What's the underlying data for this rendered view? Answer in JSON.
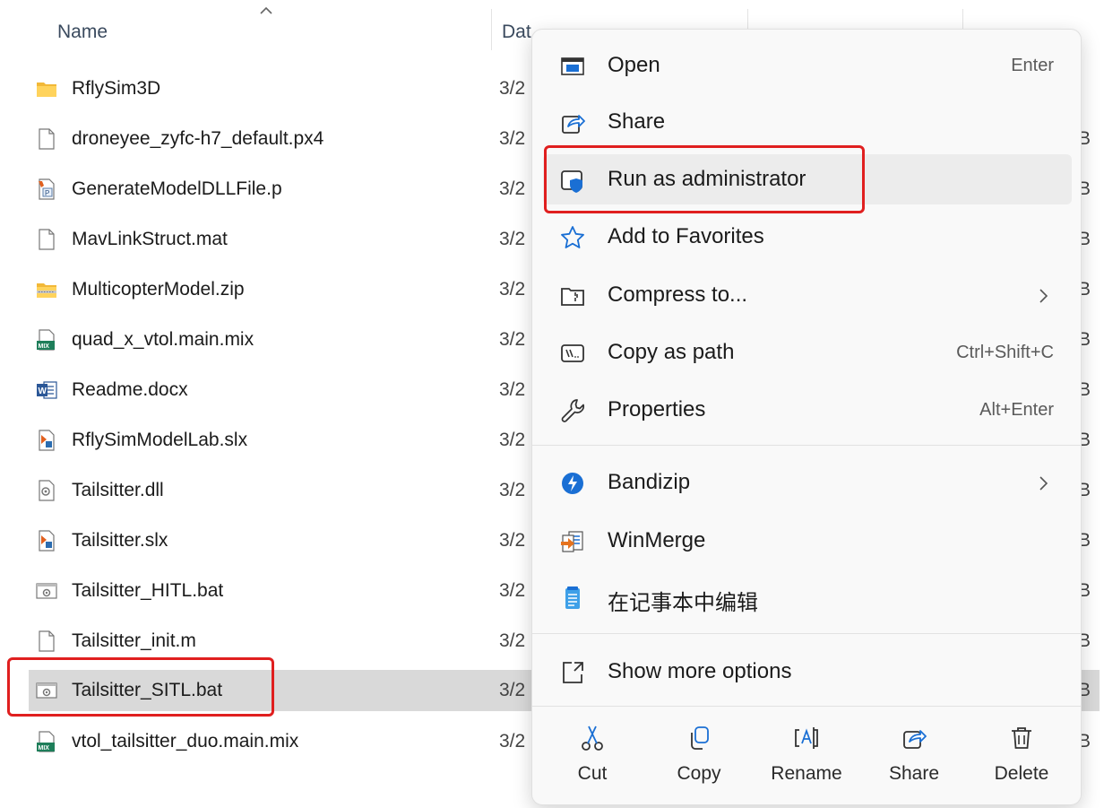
{
  "header": {
    "name_label": "Name",
    "date_label": "Dat"
  },
  "files": [
    {
      "name": "RflySim3D",
      "date": "3/2",
      "size": "",
      "icon": "folder-icon"
    },
    {
      "name": "droneyee_zyfc-h7_default.px4",
      "date": "3/2",
      "size": "B",
      "icon": "blank-file-icon"
    },
    {
      "name": "GenerateModelDLLFile.p",
      "date": "3/2",
      "size": "B",
      "icon": "matlab-p-file-icon"
    },
    {
      "name": "MavLinkStruct.mat",
      "date": "3/2",
      "size": "B",
      "icon": "blank-file-icon"
    },
    {
      "name": "MulticopterModel.zip",
      "date": "3/2",
      "size": "B",
      "icon": "zip-folder-icon"
    },
    {
      "name": "quad_x_vtol.main.mix",
      "date": "3/2",
      "size": "B",
      "icon": "mix-file-icon"
    },
    {
      "name": "Readme.docx",
      "date": "3/2",
      "size": "B",
      "icon": "word-doc-icon"
    },
    {
      "name": "RflySimModelLab.slx",
      "date": "3/2",
      "size": "B",
      "icon": "simulink-file-icon"
    },
    {
      "name": "Tailsitter.dll",
      "date": "3/2",
      "size": "B",
      "icon": "dll-file-icon"
    },
    {
      "name": "Tailsitter.slx",
      "date": "3/2",
      "size": "B",
      "icon": "simulink-file-icon"
    },
    {
      "name": "Tailsitter_HITL.bat",
      "date": "3/2",
      "size": "B",
      "icon": "batch-file-icon"
    },
    {
      "name": "Tailsitter_init.m",
      "date": "3/2",
      "size": "B",
      "icon": "blank-file-icon"
    },
    {
      "name": "Tailsitter_SITL.bat",
      "date": "3/2",
      "size": "B",
      "icon": "batch-file-icon"
    },
    {
      "name": "vtol_tailsitter_duo.main.mix",
      "date": "3/2",
      "size": "B",
      "icon": "mix-file-icon"
    }
  ],
  "selected_file": "Tailsitter_SITL.bat",
  "context_menu": {
    "items": [
      {
        "label": "Open",
        "shortcut": "Enter",
        "icon": "open-icon"
      },
      {
        "label": "Share",
        "shortcut": "",
        "icon": "share-icon"
      },
      {
        "label": "Run as administrator",
        "shortcut": "",
        "icon": "shield-icon"
      },
      {
        "label": "Add to Favorites",
        "shortcut": "",
        "icon": "star-icon"
      },
      {
        "label": "Compress to...",
        "shortcut": "",
        "icon": "compress-icon",
        "submenu": true
      },
      {
        "label": "Copy as path",
        "shortcut": "Ctrl+Shift+C",
        "icon": "copy-path-icon"
      },
      {
        "label": "Properties",
        "shortcut": "Alt+Enter",
        "icon": "wrench-icon"
      },
      {
        "label": "Bandizip",
        "shortcut": "",
        "icon": "bandizip-icon",
        "submenu": true
      },
      {
        "label": "WinMerge",
        "shortcut": "",
        "icon": "winmerge-icon"
      },
      {
        "label": "在记事本中编辑",
        "shortcut": "",
        "icon": "notepad-icon"
      },
      {
        "label": "Show more options",
        "shortcut": "",
        "icon": "more-options-icon"
      }
    ],
    "bottom_actions": [
      {
        "label": "Cut",
        "icon": "scissors-icon"
      },
      {
        "label": "Copy",
        "icon": "copy-icon"
      },
      {
        "label": "Rename",
        "icon": "rename-icon"
      },
      {
        "label": "Share",
        "icon": "share-icon"
      },
      {
        "label": "Delete",
        "icon": "trash-icon"
      }
    ]
  },
  "colors": {
    "highlight_box": "#e01f1f",
    "selected_row": "#d9d9d9",
    "accent": "#0a64c8"
  }
}
